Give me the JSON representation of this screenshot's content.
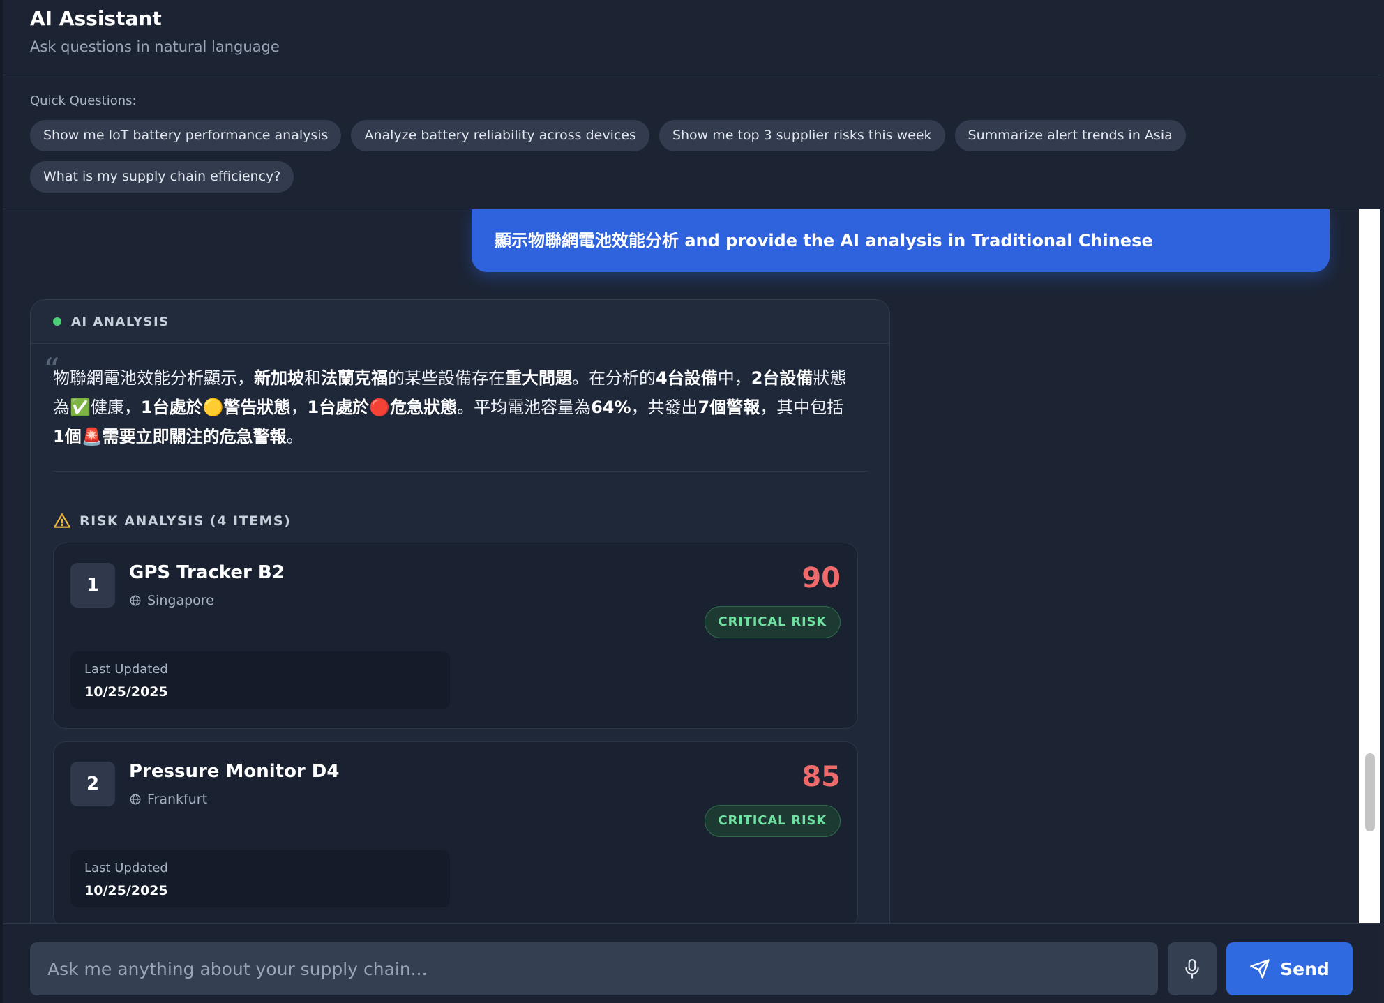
{
  "header": {
    "title": "AI Assistant",
    "subtitle": "Ask questions in natural language"
  },
  "quick_questions": {
    "label": "Quick Questions:",
    "items": [
      "Show me IoT battery performance analysis",
      "Analyze battery reliability across devices",
      "Show me top 3 supplier risks this week",
      "Summarize alert trends in Asia",
      "What is my supply chain efficiency?"
    ]
  },
  "chat": {
    "user_message": "顯示物聯網電池效能分析 and provide the AI analysis in Traditional Chinese",
    "ai_card": {
      "label": "AI ANALYSIS",
      "status_color": "#4ccf74",
      "analysis_segments": [
        {
          "text": "物聯網電池效能分析顯示，",
          "bold": false
        },
        {
          "text": "新加坡",
          "bold": true
        },
        {
          "text": "和",
          "bold": false
        },
        {
          "text": "法蘭克福",
          "bold": true
        },
        {
          "text": "的某些設備存在",
          "bold": false
        },
        {
          "text": "重大問題",
          "bold": true
        },
        {
          "text": "。在分析的",
          "bold": false
        },
        {
          "text": "4台設備",
          "bold": true
        },
        {
          "text": "中，",
          "bold": false
        },
        {
          "text": "2台設備",
          "bold": true
        },
        {
          "text": "狀態為✅健康，",
          "bold": false
        },
        {
          "text": "1台處於🟡警告狀態",
          "bold": true
        },
        {
          "text": "，",
          "bold": false
        },
        {
          "text": "1台處於🔴危急狀態",
          "bold": true
        },
        {
          "text": "。平均電池容量為",
          "bold": false
        },
        {
          "text": "64%",
          "bold": true
        },
        {
          "text": "，共發出",
          "bold": false
        },
        {
          "text": "7個警報",
          "bold": true
        },
        {
          "text": "，其中包括",
          "bold": false
        },
        {
          "text": "1個🚨需要立即關注的危急警報",
          "bold": true
        },
        {
          "text": "。",
          "bold": false
        }
      ],
      "risk_heading": "RISK ANALYSIS (4 ITEMS)",
      "risk_items": [
        {
          "rank": "1",
          "name": "GPS Tracker B2",
          "location": "Singapore",
          "score": "90",
          "badge": "CRITICAL RISK",
          "updated_label": "Last Updated",
          "updated_value": "10/25/2025"
        },
        {
          "rank": "2",
          "name": "Pressure Monitor D4",
          "location": "Frankfurt",
          "score": "85",
          "badge": "CRITICAL RISK",
          "updated_label": "Last Updated",
          "updated_value": "10/25/2025"
        }
      ]
    }
  },
  "input": {
    "placeholder": "Ask me anything about your supply chain...",
    "send_label": "Send"
  },
  "colors": {
    "accent": "#2f6ae0",
    "critical_score": "#ef6b6b",
    "badge_text": "#6fe0a0",
    "warning_icon": "#f2b93b"
  }
}
